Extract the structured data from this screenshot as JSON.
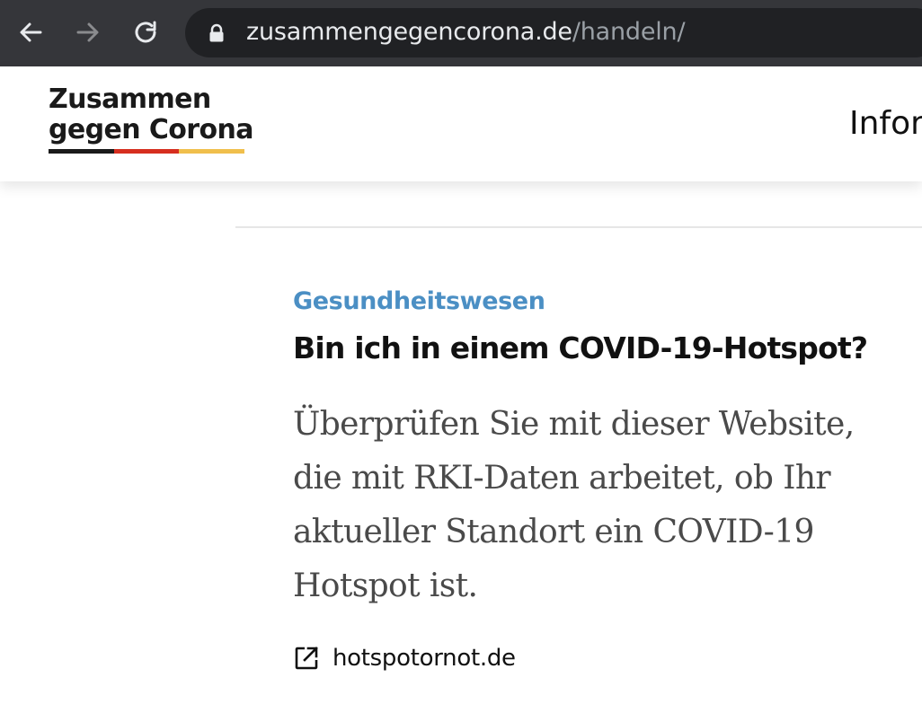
{
  "browser": {
    "url_host": "zusammengegencorona.de",
    "url_path": "/handeln/",
    "back_icon": "arrow-left-icon",
    "forward_icon": "arrow-right-icon",
    "reload_icon": "reload-icon",
    "lock_icon": "lock-icon",
    "chrome_color": "#35363a",
    "omnibox_color": "#202124"
  },
  "header": {
    "logo_line1": "Zusammen",
    "logo_line2": "gegen Corona",
    "flag_colors": [
      "#1a1a1a",
      "#d62e1f",
      "#f0bf4c"
    ],
    "nav_partial": "Infor"
  },
  "card": {
    "category": "Gesundheitswesen",
    "category_color": "#4b8fc4",
    "title": "Bin ich in einem COVID-19-Hotspot?",
    "description": "Überprüfen Sie mit dieser Website, die mit RKI-Daten arbeitet, ob Ihr aktueller Standort ein COVID-19 Hotspot ist.",
    "link_label": "hotspotornot.de",
    "link_icon": "external-link-icon"
  }
}
